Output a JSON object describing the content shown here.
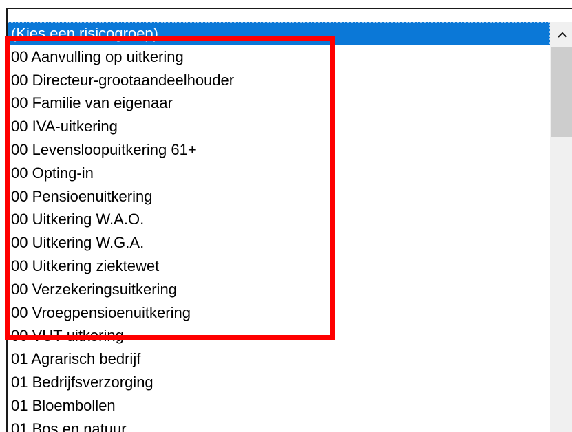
{
  "listbox": {
    "selected_index": 0,
    "items": [
      "(Kies een risicogroep)",
      "00 Aanvulling op uitkering",
      "00 Directeur-grootaandeelhouder",
      "00 Familie van eigenaar",
      "00 IVA-uitkering",
      "00 Levensloopuitkering 61+",
      "00 Opting-in",
      "00 Pensioenuitkering",
      "00 Uitkering W.A.O.",
      "00 Uitkering W.G.A.",
      "00 Uitkering ziektewet",
      "00 Verzekeringsuitkering",
      "00 Vroegpensioenuitkering",
      "00 VUT-uitkering",
      "01 Agrarisch bedrijf",
      "01 Bedrijfsverzorging",
      "01 Bloembollen",
      "01 Bos en natuur"
    ]
  },
  "scrollbar": {
    "up_icon": "chevron-up-icon"
  },
  "colors": {
    "selection": "#0b78d7",
    "highlight_box": "#ff0000",
    "scrollbar_track": "#f0f0f0",
    "scrollbar_thumb": "#cdcdcd"
  }
}
